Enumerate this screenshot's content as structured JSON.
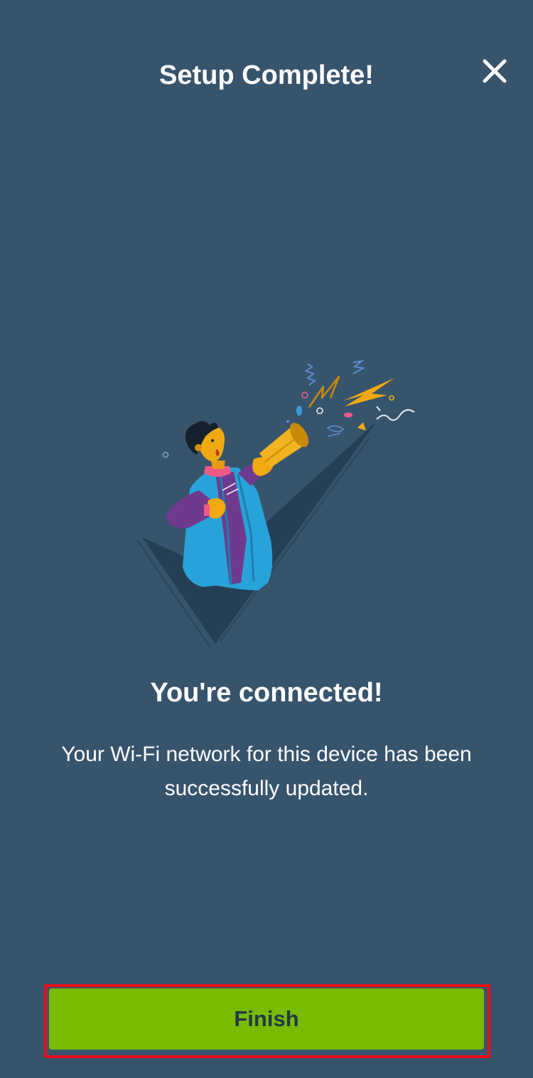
{
  "header": {
    "title": "Setup Complete!",
    "close_icon": "close-icon"
  },
  "illustration": {
    "icon": "celebration-checkmark-illustration"
  },
  "content": {
    "headline": "You're connected!",
    "message": "Your Wi-Fi network for this device has been successfully updated."
  },
  "footer": {
    "finish_label": "Finish"
  },
  "colors": {
    "background": "#37546d",
    "primary_button": "#78bb00",
    "button_text": "#22384a",
    "highlight_outline": "#e6101a"
  }
}
